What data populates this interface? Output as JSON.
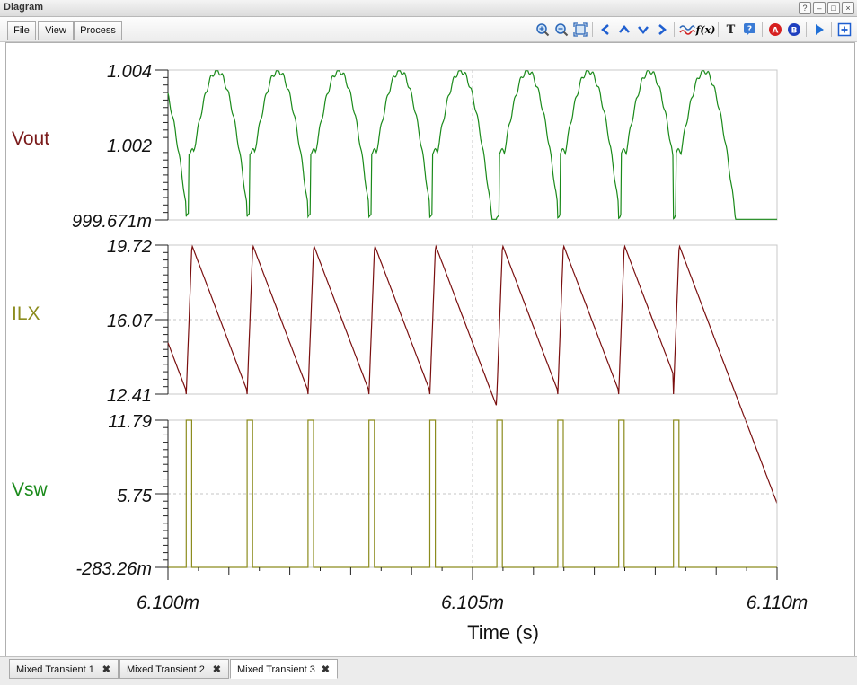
{
  "window": {
    "title": "Diagram",
    "buttons": [
      "?",
      "–",
      "□",
      "×"
    ]
  },
  "menu": {
    "file": "File",
    "view": "View",
    "process": "Process"
  },
  "toolbar_icons": [
    "zoom-in-icon",
    "zoom-out-icon",
    "fit-icon",
    "pan-left-icon",
    "pan-up-icon",
    "pan-down-icon",
    "pan-right-icon",
    "waveform-icon",
    "function-icon",
    "text-icon",
    "help-icon",
    "cursor-a-icon",
    "cursor-b-icon",
    "run-icon",
    "expand-icon"
  ],
  "colors": {
    "vout": "#1a8a1a",
    "ilx": "#7a0f0f",
    "vsw": "#8c8c1e",
    "vout_label": "#7a1a1a",
    "ilx_label": "#8c8c1e",
    "vsw_label": "#1a8a1a"
  },
  "tabs": [
    {
      "label": "Mixed Transient 1"
    },
    {
      "label": "Mixed Transient 2"
    },
    {
      "label": "Mixed Transient 3"
    }
  ],
  "chart_data": {
    "type": "line",
    "xlabel": "Time (s)",
    "x_ticks": [
      "6.100m",
      "6.105m",
      "6.110m"
    ],
    "xlim": [
      0.0061,
      0.00611
    ],
    "switching_period": 1.02e-06,
    "edges": [
      0.0061003,
      0.0061013,
      0.0061023,
      0.0061033,
      0.0061043,
      0.0061054,
      0.0061064,
      0.0061074,
      0.0061083
    ],
    "series": [
      {
        "name": "Vout",
        "ylim": [
          0.999671,
          1.004
        ],
        "y_ticks": [
          "1.004",
          "1.002",
          "999.671m"
        ],
        "min": 0.99969,
        "max": 1.00398
      },
      {
        "name": "ILX",
        "ylim": [
          12.41,
          19.72
        ],
        "y_ticks": [
          "19.72",
          "16.07",
          "12.41"
        ],
        "min": 12.41,
        "max": 19.72
      },
      {
        "name": "Vsw",
        "ylim": [
          -0.28326,
          11.79
        ],
        "y_ticks": [
          "11.79",
          "5.75",
          "-283.26m"
        ],
        "low": -0.28326,
        "high": 11.79,
        "on_time": 9e-08
      }
    ]
  }
}
